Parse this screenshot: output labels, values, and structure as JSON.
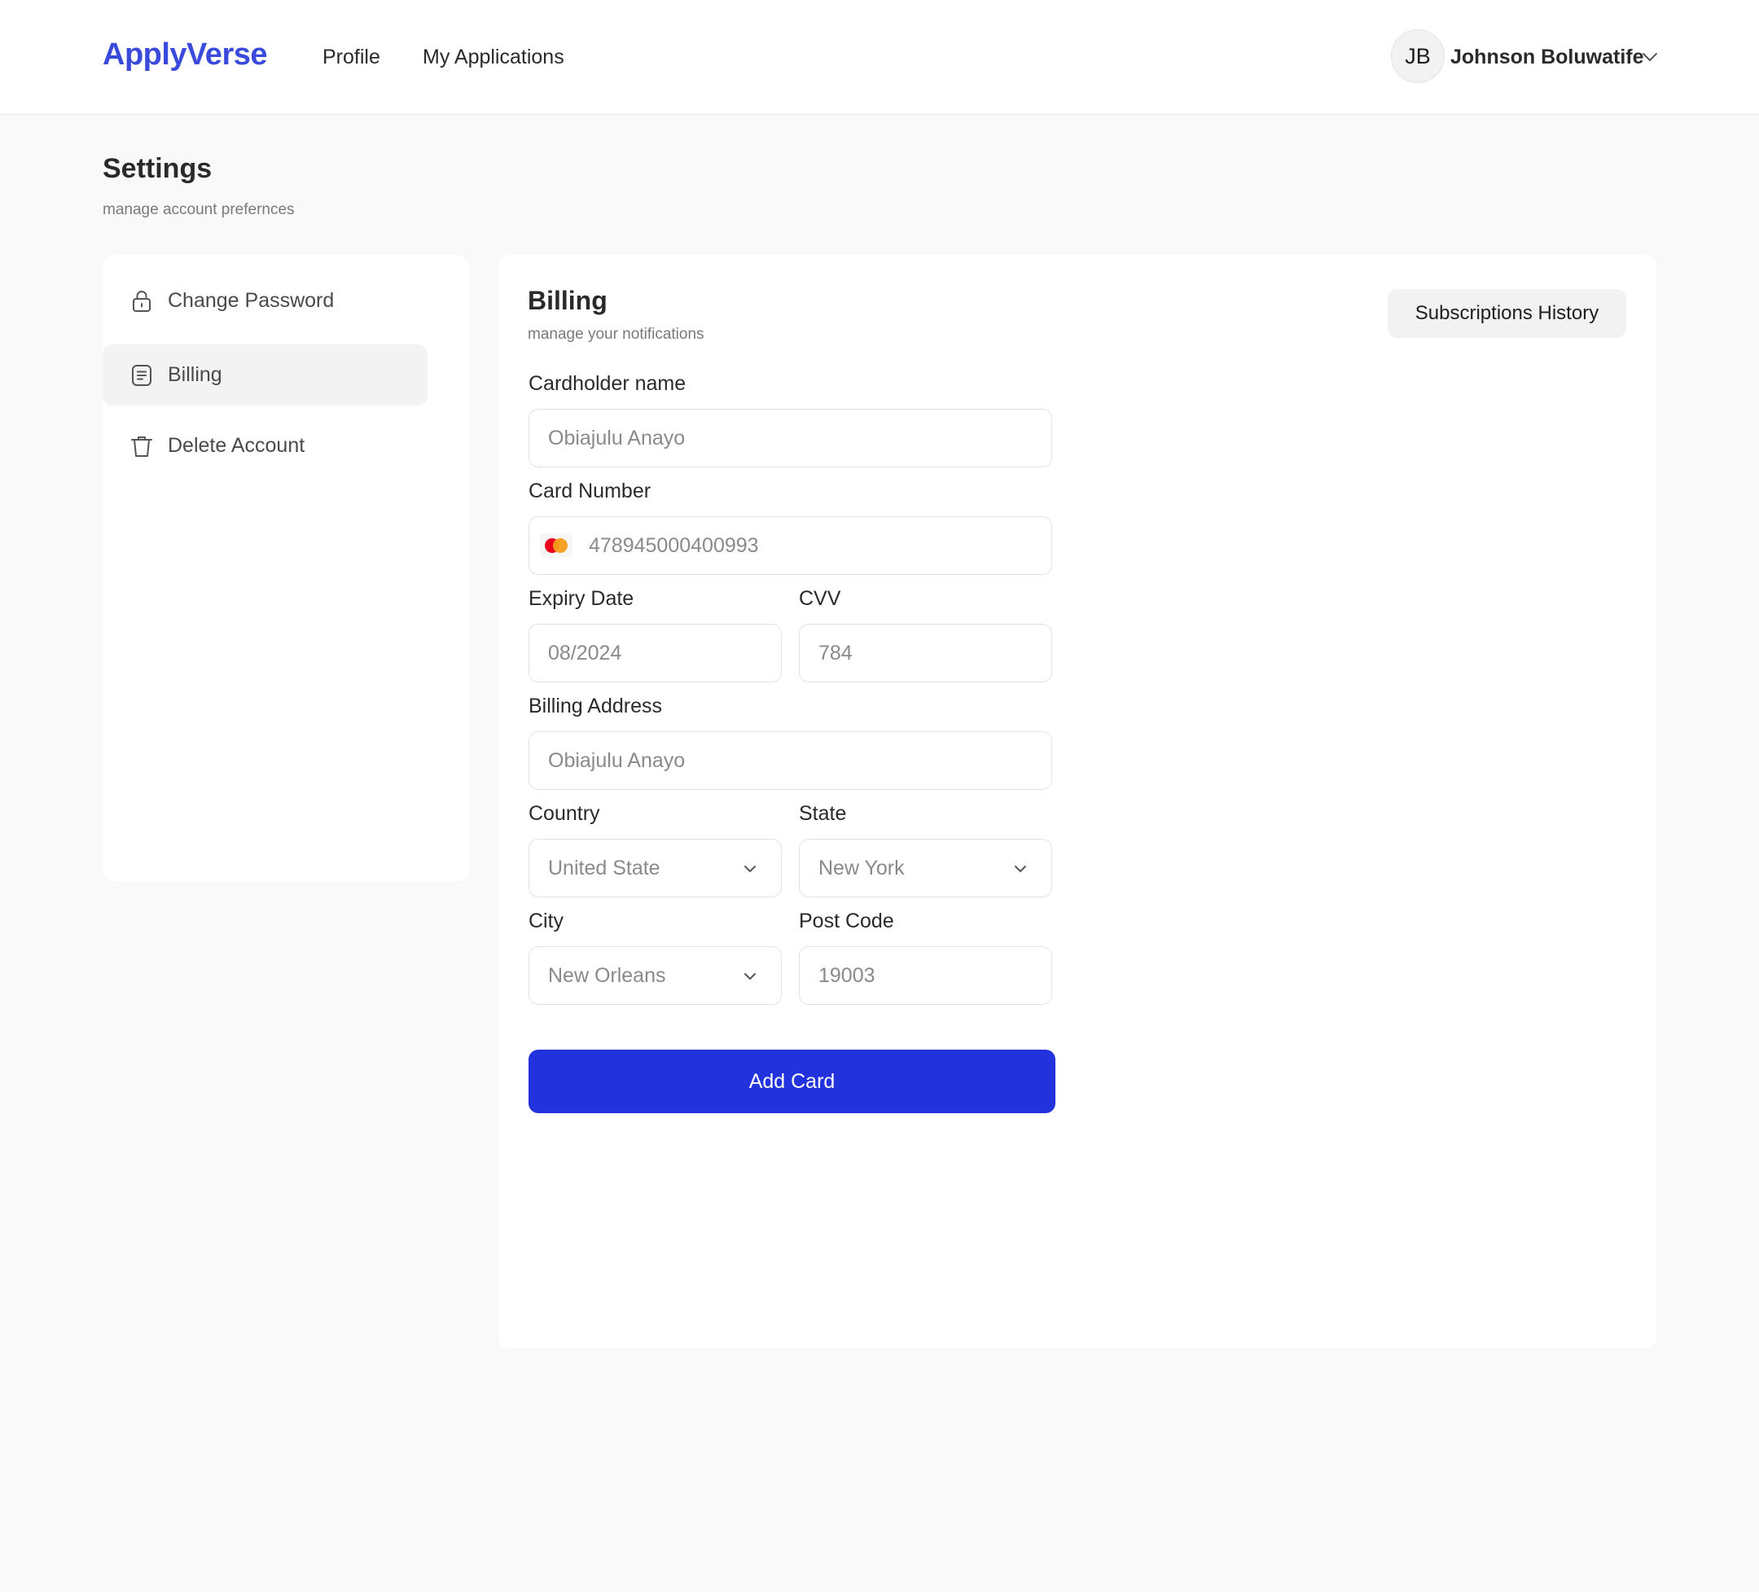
{
  "header": {
    "logo": "ApplyVerse",
    "nav": [
      {
        "label": "Profile"
      },
      {
        "label": "My Applications"
      }
    ],
    "user": {
      "initials": "JB",
      "name": "Johnson Boluwatife"
    }
  },
  "page": {
    "title": "Settings",
    "subtitle": "manage account prefernces"
  },
  "sidebar": {
    "items": [
      {
        "label": "Change Password",
        "icon": "lock-icon"
      },
      {
        "label": "Billing",
        "icon": "document-icon",
        "active": true
      },
      {
        "label": "Delete Account",
        "icon": "trash-icon"
      }
    ]
  },
  "billing": {
    "title": "Billing",
    "subtitle": "manage your notifications",
    "subscriptions_button": "Subscriptions History",
    "fields": {
      "cardholder": {
        "label": "Cardholder name",
        "value": "Obiajulu Anayo"
      },
      "card_number": {
        "label": "Card Number",
        "value": "478945000400993",
        "brand_icon": "mastercard-icon"
      },
      "expiry": {
        "label": "Expiry Date",
        "value": "08/2024"
      },
      "cvv": {
        "label": "CVV",
        "value": "784"
      },
      "address": {
        "label": "Billing Address",
        "value": "Obiajulu Anayo"
      },
      "country": {
        "label": "Country",
        "value": "United State"
      },
      "state": {
        "label": "State",
        "value": "New York"
      },
      "city": {
        "label": "City",
        "value": "New Orleans"
      },
      "postcode": {
        "label": "Post Code",
        "value": "19003"
      }
    },
    "submit_label": "Add Card"
  },
  "colors": {
    "brand": "#3a4bdc",
    "primary_button": "#2233dd",
    "mastercard_red": "#eb001b",
    "mastercard_orange": "#f79e1b"
  }
}
